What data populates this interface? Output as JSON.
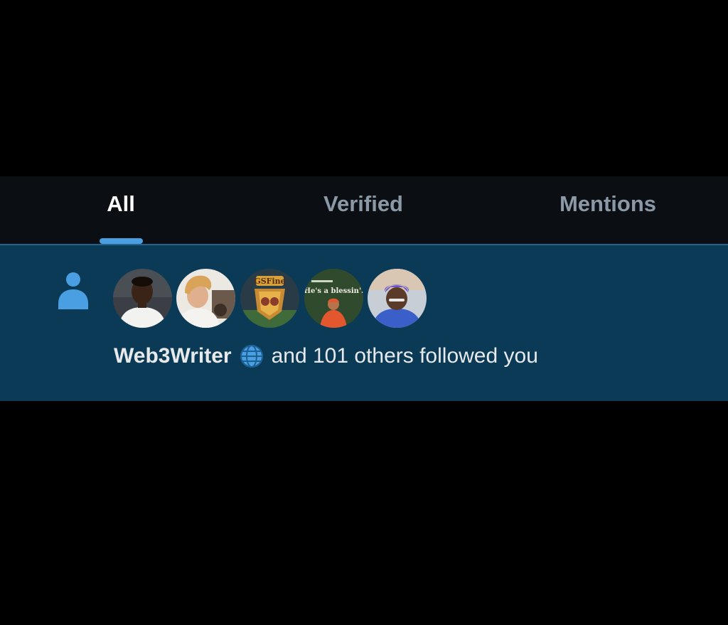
{
  "tabs": [
    {
      "label": "All",
      "active": true
    },
    {
      "label": "Verified",
      "active": false
    },
    {
      "label": "Mentions",
      "active": false
    }
  ],
  "notification": {
    "icon": "person-icon",
    "avatars": [
      {
        "name": "avatar-1"
      },
      {
        "name": "avatar-2"
      },
      {
        "name": "avatar-3",
        "caption": "GSFine"
      },
      {
        "name": "avatar-4",
        "caption": "He's a blessin'."
      },
      {
        "name": "avatar-5"
      }
    ],
    "user_name": "Web3Writer",
    "user_badge_icon": "globe-icon",
    "message": "and 101 others followed you"
  },
  "colors": {
    "page_bg": "#000000",
    "tabbar_bg": "#0b0e12",
    "tab_active": "#ffffff",
    "tab_inactive": "#8b98a5",
    "tab_indicator": "#4a9fe3",
    "notification_bg": "#0b3a56",
    "icon_blue": "#4a9fe3",
    "text": "#e7e9ea"
  }
}
